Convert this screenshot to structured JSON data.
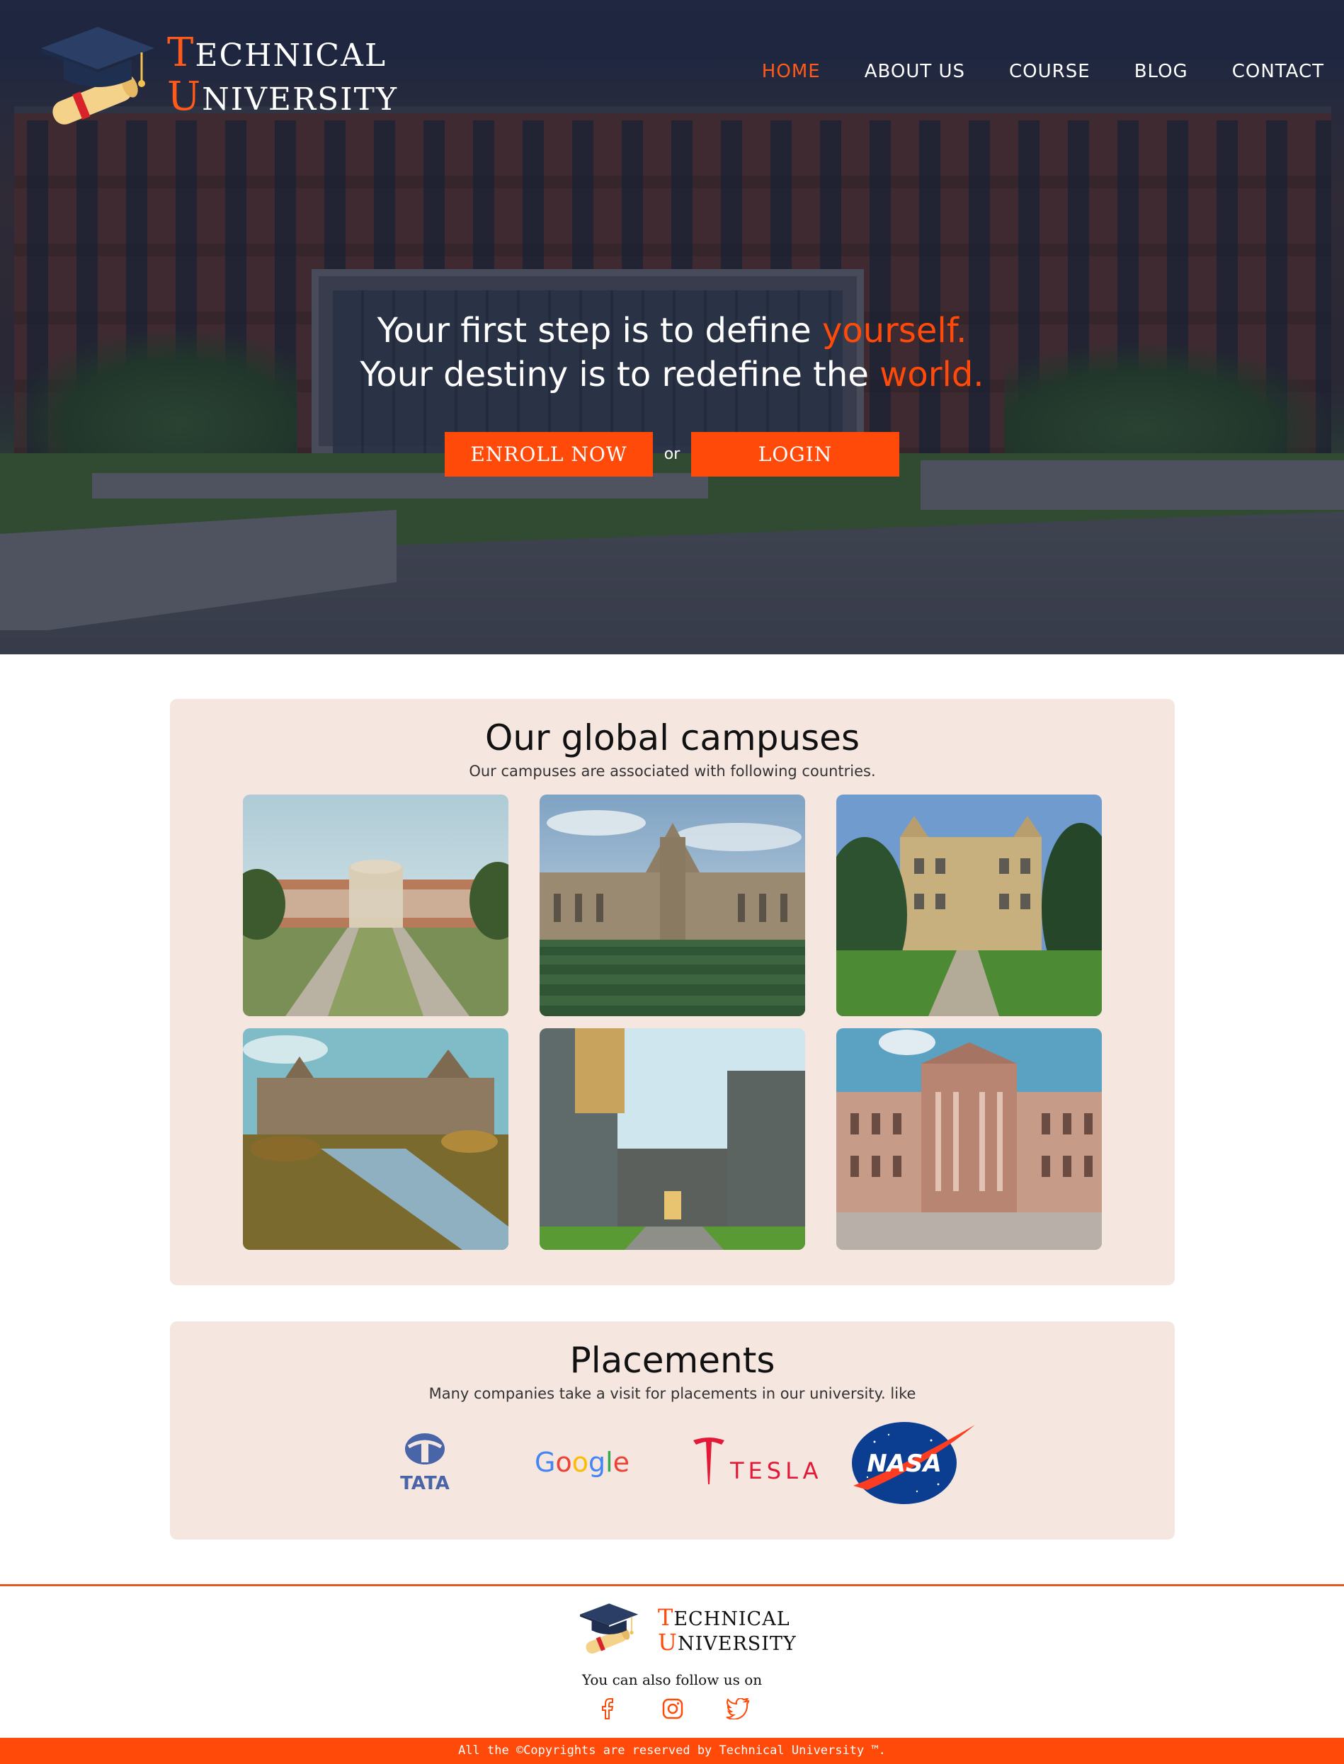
{
  "header": {
    "logo_line1_first": "T",
    "logo_line1_rest": "ECHNICAL",
    "logo_line2_first": "U",
    "logo_line2_rest": "NIVERSITY",
    "nav": [
      "HOME",
      "ABOUT US",
      "COURSE",
      "BLOG",
      "CONTACT"
    ],
    "active_nav": "HOME"
  },
  "hero": {
    "line1_text": "Your first step is to define ",
    "line1_accent": "yourself.",
    "line2_text": "Your destiny is to redefine the ",
    "line2_accent": "world.",
    "enroll_label": "ENROLL NOW",
    "or_label": "or",
    "login_label": "LOGIN"
  },
  "campuses": {
    "title": "Our global campuses",
    "subtitle": "Our campuses are associated with following countries."
  },
  "placements": {
    "title": "Placements",
    "subtitle": "Many companies take a visit for placements in our university. like",
    "brands": [
      "TATA",
      "Google",
      "TESLA",
      "NASA"
    ]
  },
  "footer": {
    "logo_line1_first": "T",
    "logo_line1_rest": "ECHNICAL",
    "logo_line2_first": "U",
    "logo_line2_rest": "NIVERSITY",
    "follow_text": "You can also follow us on",
    "copyright": "All the ©Copyrights are reserved by Technical University ™."
  },
  "colors": {
    "accent": "#ff4a0a",
    "card_bg": "#f6e6e0",
    "hero_overlay": "#141a30"
  },
  "icons": [
    "graduation-cap-icon",
    "diploma-icon",
    "facebook-icon",
    "instagram-icon",
    "twitter-icon"
  ]
}
